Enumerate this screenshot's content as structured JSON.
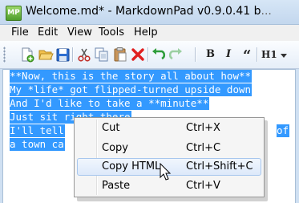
{
  "window": {
    "app_icon_text": "MP",
    "title": "Welcome.md* - MarkdownPad v0.9.0.41 b",
    "title_overflow": "..."
  },
  "menubar": {
    "items": [
      "File",
      "Edit",
      "View",
      "Tools",
      "Help"
    ]
  },
  "toolbar": {
    "buttons": [
      {
        "name": "new-document",
        "icon": "new-document-icon"
      },
      {
        "name": "open-folder",
        "icon": "folder-open-icon"
      },
      {
        "name": "save",
        "icon": "save-disk-icon"
      },
      {
        "name": "cut",
        "icon": "scissors-icon"
      },
      {
        "name": "copy",
        "icon": "copy-icon"
      },
      {
        "name": "paste",
        "icon": "clipboard-icon"
      },
      {
        "name": "delete",
        "icon": "red-x-icon"
      },
      {
        "name": "undo",
        "icon": "undo-arrow-icon"
      },
      {
        "name": "redo",
        "icon": "redo-arrow-icon"
      }
    ],
    "format": {
      "bold": "B",
      "italic": "I",
      "quote": "“",
      "heading": "H1"
    },
    "colors": {
      "save": "#2f6fd0",
      "delete": "#e02020",
      "undo_redo": "#2e9d3a"
    }
  },
  "editor": {
    "selection_color": "#3399ff",
    "lines": [
      "**Now, this is the story all about how**",
      "My *life* got flipped-turned upside down",
      "And I'd like to take a **minute**",
      "Just sit right there",
      "I'll tell",
      "a town ca"
    ],
    "line_tail": "of"
  },
  "context_menu": {
    "items": [
      {
        "label": "Cut",
        "shortcut": "Ctrl+X"
      },
      {
        "label": "Copy",
        "shortcut": "Ctrl+C"
      },
      {
        "label": "Copy HTML",
        "shortcut": "Ctrl+Shift+C"
      },
      {
        "label": "Paste",
        "shortcut": "Ctrl+V"
      }
    ],
    "hovered_item": "Copy HTML"
  }
}
